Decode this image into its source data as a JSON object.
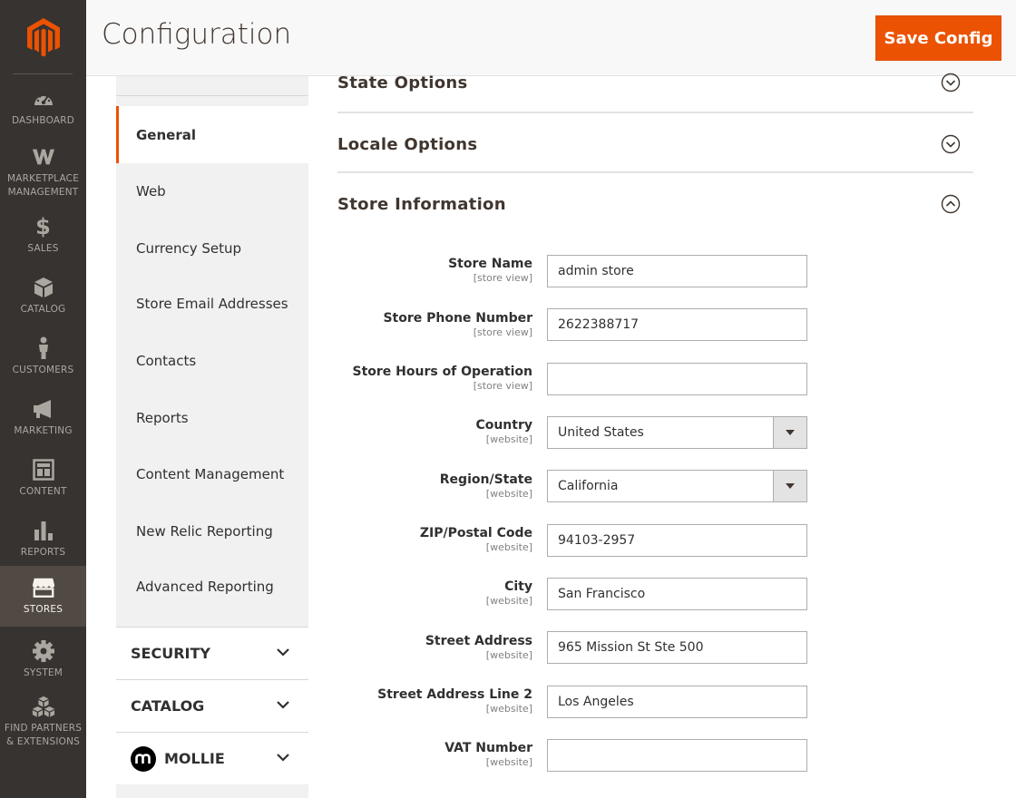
{
  "admin_menu": {
    "items": [
      {
        "label": "DASHBOARD",
        "icon": "dashboard-icon"
      },
      {
        "label": "MARKETPLACE MANAGEMENT",
        "icon": "marketplace-icon"
      },
      {
        "label": "SALES",
        "icon": "dollar-icon"
      },
      {
        "label": "CATALOG",
        "icon": "box-icon"
      },
      {
        "label": "CUSTOMERS",
        "icon": "person-icon"
      },
      {
        "label": "MARKETING",
        "icon": "megaphone-icon"
      },
      {
        "label": "CONTENT",
        "icon": "layout-icon"
      },
      {
        "label": "REPORTS",
        "icon": "bar-chart-icon"
      },
      {
        "label": "STORES",
        "icon": "storefront-icon",
        "active": true
      },
      {
        "label": "SYSTEM",
        "icon": "gear-icon"
      },
      {
        "label": "FIND PARTNERS & EXTENSIONS",
        "icon": "cubes-icon"
      }
    ]
  },
  "header": {
    "title": "Configuration",
    "save_label": "Save Config"
  },
  "tabs": {
    "items": [
      {
        "label": "General",
        "active": true
      },
      {
        "label": "Web"
      },
      {
        "label": "Currency Setup"
      },
      {
        "label": "Store Email Addresses"
      },
      {
        "label": "Contacts"
      },
      {
        "label": "Reports"
      },
      {
        "label": "Content Management"
      },
      {
        "label": "New Relic Reporting"
      },
      {
        "label": "Advanced Reporting"
      }
    ],
    "groups": [
      {
        "label": "SECURITY"
      },
      {
        "label": "CATALOG"
      },
      {
        "label": "MOLLIE"
      }
    ]
  },
  "sections": [
    {
      "title": "State Options",
      "expanded": false
    },
    {
      "title": "Locale Options",
      "expanded": false
    },
    {
      "title": "Store Information",
      "expanded": true
    }
  ],
  "store_information": {
    "fields": [
      {
        "label": "Store Name",
        "scope": "[store view]",
        "type": "text",
        "value": "admin store"
      },
      {
        "label": "Store Phone Number",
        "scope": "[store view]",
        "type": "text",
        "value": "2622388717"
      },
      {
        "label": "Store Hours of Operation",
        "scope": "[store view]",
        "type": "text",
        "value": ""
      },
      {
        "label": "Country",
        "scope": "[website]",
        "type": "select",
        "value": "United States"
      },
      {
        "label": "Region/State",
        "scope": "[website]",
        "type": "select",
        "value": "California"
      },
      {
        "label": "ZIP/Postal Code",
        "scope": "[website]",
        "type": "text",
        "value": "94103-2957"
      },
      {
        "label": "City",
        "scope": "[website]",
        "type": "text",
        "value": "San Francisco"
      },
      {
        "label": "Street Address",
        "scope": "[website]",
        "type": "text",
        "value": "965 Mission St Ste 500"
      },
      {
        "label": "Street Address Line 2",
        "scope": "[website]",
        "type": "text",
        "value": "Los Angeles"
      },
      {
        "label": "VAT Number",
        "scope": "[website]",
        "type": "text",
        "value": ""
      }
    ]
  },
  "colors": {
    "menu_bg": "#373330",
    "menu_active_bg": "#514943",
    "accent": "#eb5202",
    "logo": "#eb5202"
  }
}
